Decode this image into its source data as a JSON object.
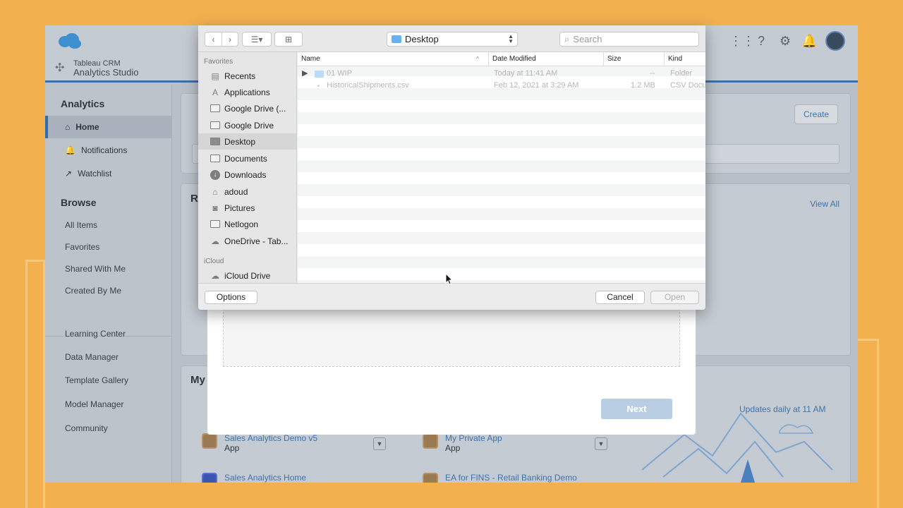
{
  "app": {
    "brand_line1": "Tableau CRM",
    "brand_line2": "Analytics Studio"
  },
  "sidebar": {
    "analytics_heading": "Analytics",
    "items": [
      {
        "label": "Home",
        "icon": "home-icon"
      },
      {
        "label": "Notifications",
        "icon": "bell-icon"
      },
      {
        "label": "Watchlist",
        "icon": "trend-icon"
      }
    ],
    "browse_heading": "Browse",
    "browse_links": [
      "All Items",
      "Favorites",
      "Shared With Me",
      "Created By Me"
    ],
    "other_links": [
      "Learning Center",
      "Data Manager",
      "Template Gallery",
      "Model Manager",
      "Community"
    ]
  },
  "main": {
    "create_label": "Create",
    "view_all_label": "View All",
    "my_heading": "My",
    "recent_heading": "R",
    "updates_text": "Updates daily at 11 AM",
    "apps": [
      {
        "name": "Sales Analytics Demo v5",
        "type": "App"
      },
      {
        "name": "My Private App",
        "type": "App"
      },
      {
        "name": "Sales Analytics Home",
        "type": ""
      },
      {
        "name": "EA for FINS - Retail Banking Demo",
        "type": ""
      }
    ]
  },
  "wizard": {
    "next_label": "Next"
  },
  "file_dialog": {
    "location": "Desktop",
    "search_placeholder": "Search",
    "sidebar_heading_favorites": "Favorites",
    "sidebar_heading_icloud": "iCloud",
    "favorites": [
      {
        "label": "Recents",
        "icon": "recents-icon"
      },
      {
        "label": "Applications",
        "icon": "applications-icon"
      },
      {
        "label": "Google Drive (...",
        "icon": "folder-icon"
      },
      {
        "label": "Google Drive",
        "icon": "folder-icon"
      },
      {
        "label": "Desktop",
        "icon": "desktop-icon",
        "selected": true
      },
      {
        "label": "Documents",
        "icon": "documents-icon"
      },
      {
        "label": "Downloads",
        "icon": "downloads-icon"
      },
      {
        "label": "adoud",
        "icon": "home-icon"
      },
      {
        "label": "Pictures",
        "icon": "camera-icon"
      },
      {
        "label": "Netlogon",
        "icon": "folder-icon"
      },
      {
        "label": "OneDrive - Tab...",
        "icon": "cloud-icon"
      }
    ],
    "icloud": [
      {
        "label": "iCloud Drive",
        "icon": "cloud-icon"
      }
    ],
    "columns": {
      "name": "Name",
      "date": "Date Modified",
      "size": "Size",
      "kind": "Kind"
    },
    "files": [
      {
        "name": "01 WIP",
        "date": "Today at 11:41 AM",
        "size": "--",
        "kind": "Folder",
        "is_folder": true
      },
      {
        "name": "HistoricalShipments.csv",
        "date": "Feb 12, 2021 at 3:29 AM",
        "size": "1.2 MB",
        "kind": "CSV Docu",
        "is_folder": false
      }
    ],
    "options_label": "Options",
    "cancel_label": "Cancel",
    "open_label": "Open"
  }
}
